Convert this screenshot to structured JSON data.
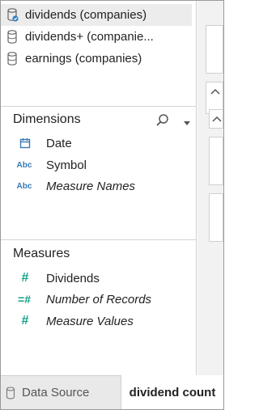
{
  "data_sources": [
    {
      "label": "dividends (companies)",
      "selected": true,
      "icon": "database-check-icon"
    },
    {
      "label": "dividends+ (companie...",
      "selected": false,
      "icon": "database-icon"
    },
    {
      "label": "earnings (companies)",
      "selected": false,
      "icon": "database-icon"
    }
  ],
  "dimensions": {
    "title": "Dimensions",
    "fields": [
      {
        "label": "Date",
        "icon": "calendar-icon"
      },
      {
        "label": "Symbol",
        "icon_text": "Abc"
      },
      {
        "label": "Measure Names",
        "icon_text": "Abc"
      }
    ]
  },
  "measures": {
    "title": "Measures",
    "fields": [
      {
        "label": "Dividends",
        "icon_text": "#"
      },
      {
        "label": "Number of Records",
        "icon_text": "=#"
      },
      {
        "label": "Measure Values",
        "icon_text": "#"
      }
    ]
  },
  "tabs": {
    "data_source": "Data Source",
    "sheet": "dividend count"
  },
  "colors": {
    "dimension": "#3a79b6",
    "measure": "#12a189",
    "selected_row": "#ececec"
  }
}
